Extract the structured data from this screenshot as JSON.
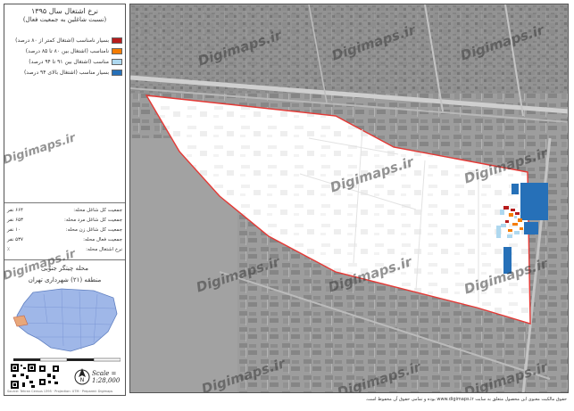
{
  "legend": {
    "title": "نرخ اشتغال سال ۱۳۹۵",
    "subtitle": "(نسبت شاغلین به جمعیت فعال)",
    "items": [
      {
        "label": "بسیار نامناسب (اشتغال کمتر از ۸۰ درصد)",
        "color": "#b71c1c"
      },
      {
        "label": "نامناسب (اشتغال بین ۸۰ تا ۸۵ درصد)",
        "color": "#f57c00"
      },
      {
        "label": "مناسب (اشتغال بین ۹۱ تا ۹۴ درصد)",
        "color": "#aed8ef"
      },
      {
        "label": "بسیار مناسب (اشتغال بالای ۹۴ درصد)",
        "color": "#2670b8"
      }
    ]
  },
  "stats": [
    {
      "label": "جمعیت کل شاغل محله:",
      "value": "۶۶۴ نفر"
    },
    {
      "label": "جمعیت کل شاغل مرد محله:",
      "value": "۶۵۳ نفر"
    },
    {
      "label": "جمعیت کل شاغل زن محله:",
      "value": "۱۰ نفر"
    },
    {
      "label": "جمعیت فعال محله:",
      "value": "۵۳۷ نفر"
    },
    {
      "label": "نرخ اشتغال محله:",
      "value": "٪"
    }
  ],
  "district": "محله چیتگر جنوبی",
  "region": "منطقه (۲۱) شهرداری تهران",
  "scale": "Scale = 1:28,000",
  "credits": "Source: Tehran Census 1395 · Projection: UTM · Prepared: Digimaps",
  "watermark": "Digimaps.ir",
  "footer": "حقوق مالکیت معنوی این محصول متعلق به سایت www.digimaps.ir بوده و تمامی حقوق آن محفوظ است.",
  "colors": {
    "boundary": "#e53935",
    "very_good": "#2670b8",
    "good": "#aed8ef",
    "poor": "#f57c00",
    "very_poor": "#b71c1c"
  },
  "icons": [
    "north-arrow-icon",
    "qr-code-icon"
  ]
}
